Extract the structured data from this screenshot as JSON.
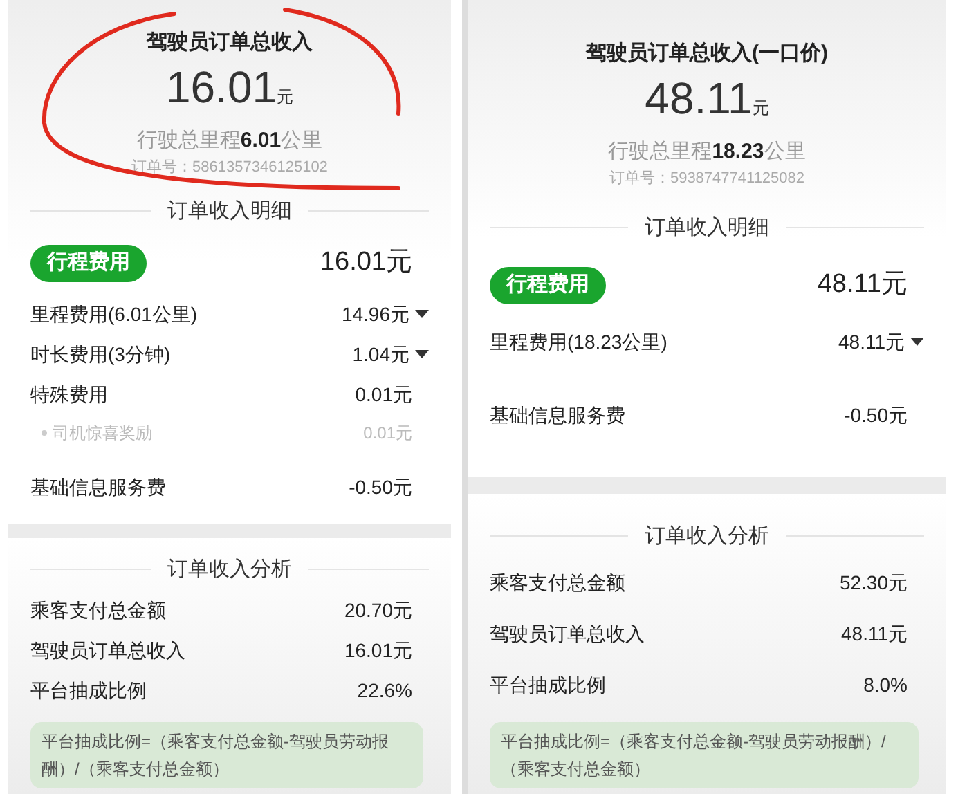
{
  "panels": [
    {
      "annotated": true,
      "title": "驾驶员订单总收入",
      "amount": "16.01",
      "amount_unit": "元",
      "distance_prefix": "行驶总里程",
      "distance_value": "6.01",
      "distance_unit": "公里",
      "order_no": "订单号：5861357346125102",
      "detail_heading": "订单收入明细",
      "trip_badge": "行程费用",
      "trip_total": "16.01元",
      "items": [
        {
          "kind": "item",
          "label": "里程费用(6.01公里)",
          "value": "14.96元",
          "expandable": true
        },
        {
          "kind": "item",
          "label": "时长费用(3分钟)",
          "value": "1.04元",
          "expandable": true
        },
        {
          "kind": "item",
          "label": "特殊费用",
          "value": "0.01元",
          "expandable": false
        },
        {
          "kind": "sub",
          "label": "司机惊喜奖励",
          "value": "0.01元",
          "expandable": false
        }
      ],
      "service_fee": {
        "label": "基础信息服务费",
        "value": "-0.50元"
      },
      "analysis_heading": "订单收入分析",
      "analysis": [
        {
          "label": "乘客支付总金额",
          "value": "20.70元"
        },
        {
          "label": "驾驶员订单总收入",
          "value": "16.01元"
        },
        {
          "label": "平台抽成比例",
          "value": "22.6%"
        }
      ],
      "formula": "平台抽成比例=（乘客支付总金额-驾驶员劳动报酬）/（乘客支付总金额）"
    },
    {
      "title": "驾驶员订单总收入(一口价)",
      "amount": "48.11",
      "amount_unit": "元",
      "distance_prefix": "行驶总里程",
      "distance_value": "18.23",
      "distance_unit": "公里",
      "order_no": "订单号：5938747741125082",
      "detail_heading": "订单收入明细",
      "trip_badge": "行程费用",
      "trip_total": "48.11元",
      "items": [
        {
          "kind": "item",
          "label": "里程费用(18.23公里)",
          "value": "48.11元",
          "expandable": true
        }
      ],
      "service_fee": {
        "label": "基础信息服务费",
        "value": "-0.50元"
      },
      "analysis_heading": "订单收入分析",
      "analysis": [
        {
          "label": "乘客支付总金额",
          "value": "52.30元"
        },
        {
          "label": "驾驶员订单总收入",
          "value": "48.11元"
        },
        {
          "label": "平台抽成比例",
          "value": "8.0%"
        }
      ],
      "formula": "平台抽成比例=（乘客支付总金额-驾驶员劳动报酬）/（乘客支付总金额）"
    }
  ]
}
